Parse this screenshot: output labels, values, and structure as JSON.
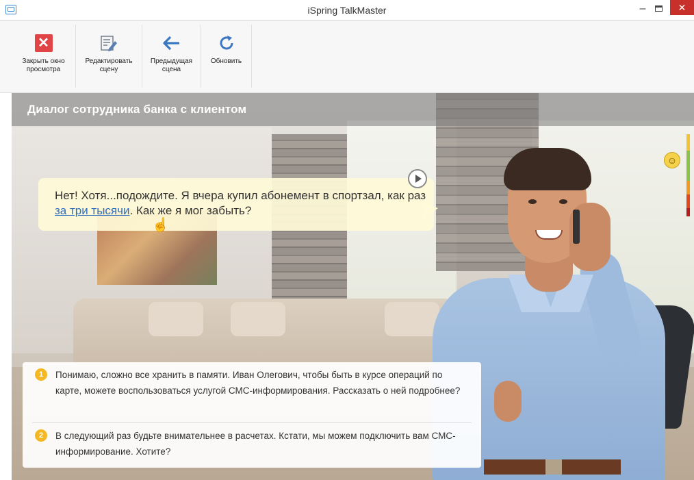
{
  "window": {
    "title": "iSpring TalkMaster",
    "minimize": "–",
    "close": "✕"
  },
  "toolbar": {
    "close_label": "Закрыть окно просмотра",
    "edit_label": "Редактировать сцену",
    "prev_label": "Предыдущая сцена",
    "refresh_label": "Обновить"
  },
  "scene": {
    "title": "Диалог сотрудника банка с клиентом"
  },
  "bubble": {
    "text_before": "Нет! Хотя...подождите. Я вчера купил абонемент в спортзал, как раз ",
    "link_text": "за три тысячи",
    "text_after": ". Как же я мог забыть?"
  },
  "mood": {
    "face": "☺",
    "colors": [
      "#f1c233",
      "#8bc34a",
      "#f29a1f",
      "#e2471e",
      "#b71c1c"
    ]
  },
  "answers": [
    {
      "number": "1",
      "text": "Понимаю, сложно все хранить в памяти. Иван Олегович, чтобы быть в курсе операций по карте, можете воспользоваться услугой СМС-информирования. Рассказать о ней подробнее?"
    },
    {
      "number": "2",
      "text": "В следующий раз будьте внимательнее в расчетах. Кстати, мы можем подключить вам СМС-информирование. Хотите?"
    }
  ]
}
